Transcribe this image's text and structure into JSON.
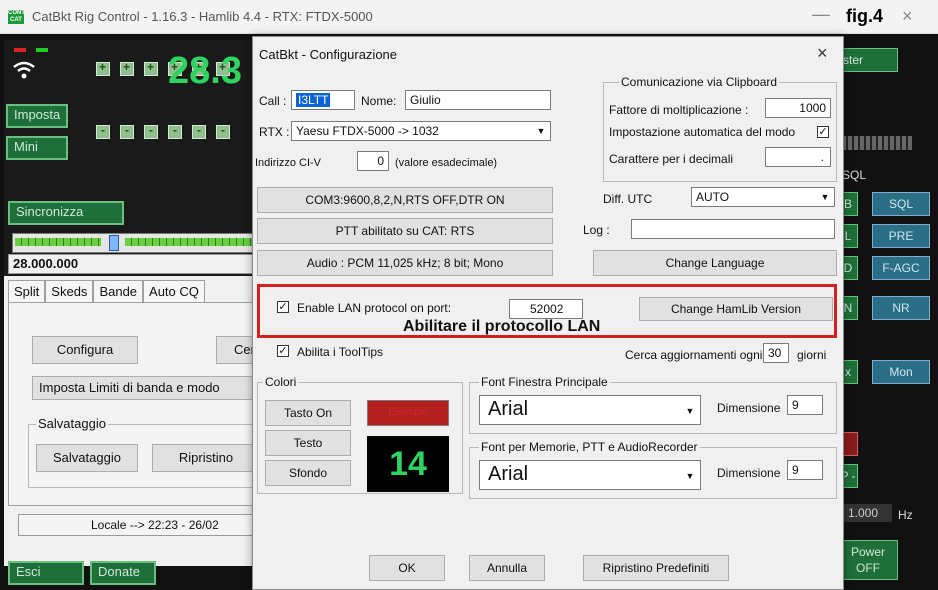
{
  "window": {
    "title": "CatBkt Rig Control - 1.16.3 - Hamlib 4.4  -  RTX: FTDX-5000",
    "app_icon_text": "CONT CAT",
    "fig_label": "fig.4",
    "minimize": "—",
    "close": "×"
  },
  "main": {
    "frequency_big": "28.3",
    "buttons": {
      "imposta": "Imposta",
      "mini": "Mini",
      "sincronizza": "Sincronizza",
      "esci": "Esci",
      "donate": "Donate"
    },
    "freq_readout": "28.000.000",
    "meter_fraction": 0.4,
    "tabs": [
      "Split",
      "Skeds",
      "Bande",
      "Auto CQ"
    ],
    "configura_button": "Configura",
    "cer_button": "Cer",
    "limiti_button": "Imposta Limiti di banda e modo",
    "salvataggio_group": "Salvataggio",
    "salvataggio_button": "Salvataggio",
    "ripristino_button": "Ripristino",
    "status_text": "Locale --> 22:23  -  26/02",
    "right_buttons": {
      "ster": "ster",
      "sql_label": "SQL",
      "sql": "SQL",
      "pre": "PRE",
      "fagc": "F-AGC",
      "nr": "NR",
      "mon": "Mon",
      "hz_value": "1.000",
      "hz_unit": "Hz",
      "power_off": "Power OFF",
      "x_btn": "x",
      "b_btn": "B",
      "l_btn": "L",
      "n_btn": "N",
      "d_btn": "D",
      "p_btn": "P -"
    }
  },
  "dialog": {
    "title": "CatBkt - Configurazione",
    "close": "×",
    "call_label": "Call :",
    "call_value": "I3LTT",
    "nome_label": "Nome:",
    "nome_value": "Giulio",
    "rtx_label": "RTX :",
    "rtx_value": "Yaesu FTDX-5000 -> 1032",
    "civ_label": "Indirizzo CI-V",
    "civ_value": "0",
    "civ_hint": "(valore esadecimale)",
    "clipboard_group": "Comunicazione via Clipboard",
    "fattore_label": "Fattore di moltiplicazione :",
    "fattore_value": "1000",
    "imp_auto_label": "Impostazione automatica del modo",
    "imp_auto_checked": true,
    "car_dec_label": "Carattere per i decimali",
    "car_dec_value": ".",
    "com_button": "COM3:9600,8,2,N,RTS OFF,DTR ON",
    "ptt_button": "PTT abilitato su CAT: RTS",
    "audio_button": "Audio : PCM 11,025 kHz; 8 bit; Mono",
    "diff_utc_label": "Diff. UTC",
    "diff_utc_value": "AUTO",
    "log_label": "Log :",
    "log_value": "",
    "change_language": "Change Language",
    "lan_checkbox_label": "Enable LAN protocol on port:",
    "lan_checked": true,
    "lan_port": "52002",
    "change_hamlib": "Change HamLib Version",
    "annotation": "Abilitare il protocollo LAN",
    "tooltips_label": "Abilita i ToolTips",
    "tooltips_checked": true,
    "cerca_label": "Cerca aggiornamenti ogni",
    "cerca_value": "30",
    "cerca_unit": "giorni",
    "colori_group": "Colori",
    "tasto_on": "Tasto On",
    "testo": "Testo",
    "sfondo": "Sfondo",
    "preview_red_text": "Esempio",
    "preview_number": "14",
    "font_main_group": "Font Finestra Principale",
    "font_main_value": "Arial",
    "dimensione_label": "Dimensione",
    "dimensione_main": "9",
    "font_mem_group": "Font per Memorie, PTT e AudioRecorder",
    "font_mem_value": "Arial",
    "dimensione_mem": "9",
    "ok": "OK",
    "annulla": "Annulla",
    "ripristino": "Ripristino Predefiniti"
  },
  "colors": {
    "accent_red": "#d42020",
    "lcd_green": "#2fd35f",
    "selection_blue": "#0a64d2"
  }
}
